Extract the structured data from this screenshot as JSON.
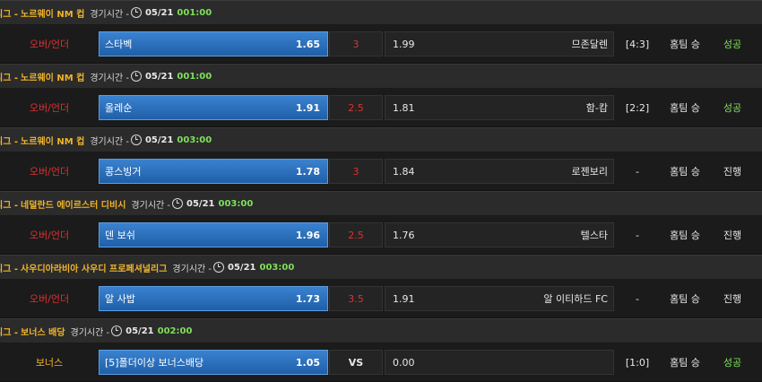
{
  "time_label": "경기시간 -",
  "games": [
    {
      "league_prefix": "리그 -",
      "league_name": "노르웨이 NM 컵",
      "date": "05/21",
      "time": "001:00",
      "bet_type": "오버/언더",
      "home_team": "스타벡",
      "home_odds": "1.65",
      "line": "3",
      "away_odds": "1.99",
      "away_team": "므존달렌",
      "score": "[4:3]",
      "pick": "홈팀 승",
      "status": "성공"
    },
    {
      "league_prefix": "리그 -",
      "league_name": "노르웨이 NM 컵",
      "date": "05/21",
      "time": "001:00",
      "bet_type": "오버/언더",
      "home_team": "올레순",
      "home_odds": "1.91",
      "line": "2.5",
      "away_odds": "1.81",
      "away_team": "함-캄",
      "score": "[2:2]",
      "pick": "홈팀 승",
      "status": "성공"
    },
    {
      "league_prefix": "리그 -",
      "league_name": "노르웨이 NM 컵",
      "date": "05/21",
      "time": "003:00",
      "bet_type": "오버/언더",
      "home_team": "콩스빙거",
      "home_odds": "1.78",
      "line": "3",
      "away_odds": "1.84",
      "away_team": "로젠보리",
      "score": "-",
      "pick": "홈팀 승",
      "status": "진행"
    },
    {
      "league_prefix": "리그 -",
      "league_name": "네덜란드 에이르스터 디비시",
      "date": "05/21",
      "time": "003:00",
      "bet_type": "오버/언더",
      "home_team": "덴 보쉬",
      "home_odds": "1.96",
      "line": "2.5",
      "away_odds": "1.76",
      "away_team": "텔스타",
      "score": "-",
      "pick": "홈팀 승",
      "status": "진행"
    },
    {
      "league_prefix": "리그 -",
      "league_name": "사우디아라비아 사우디 프로페셔널리그",
      "date": "05/21",
      "time": "003:00",
      "bet_type": "오버/언더",
      "home_team": "알 사밥",
      "home_odds": "1.73",
      "line": "3.5",
      "away_odds": "1.91",
      "away_team": "알 이티하드 FC",
      "score": "-",
      "pick": "홈팀 승",
      "status": "진행"
    },
    {
      "league_prefix": "리그 -",
      "league_name": "보너스 배당",
      "date": "05/21",
      "time": "002:00",
      "bet_type": "보너스",
      "home_team": "[5]폴더이상 보너스배당",
      "home_odds": "1.05",
      "line": "VS",
      "away_odds": "0.00",
      "away_team": "",
      "score": "[1:0]",
      "pick": "홈팀 승",
      "status": "성공"
    }
  ]
}
